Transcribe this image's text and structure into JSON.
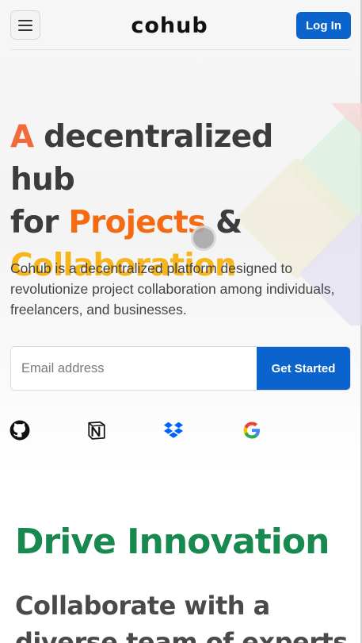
{
  "header": {
    "menu_icon": "hamburger-menu-icon",
    "logo_text": "cohub",
    "login_label": "Log In",
    "accent_color": "#0b63ce"
  },
  "hero": {
    "title_a": "A",
    "title_mid1": " decentralized hub",
    "title_for": "for ",
    "title_projects": "Projects",
    "title_amp": " &",
    "title_collab": "Collaboration",
    "description": "Cohub is a decentralized platform designed to revolutionize project collaboration among individuals, freelancers, and businesses.",
    "colors": {
      "a": "#f26a3a",
      "projects": "#f56b14",
      "collaboration": "#f7b51c"
    }
  },
  "signup": {
    "email_placeholder": "Email address",
    "email_value": "",
    "submit_label": "Get Started"
  },
  "partners": [
    {
      "icon": "github-icon"
    },
    {
      "icon": "notion-icon"
    },
    {
      "icon": "dropbox-icon"
    },
    {
      "icon": "google-icon"
    }
  ],
  "section": {
    "title": "Drive Innovation",
    "title_color": "#198a4f",
    "subtitle": "Collaborate with a diverse team of experts"
  }
}
